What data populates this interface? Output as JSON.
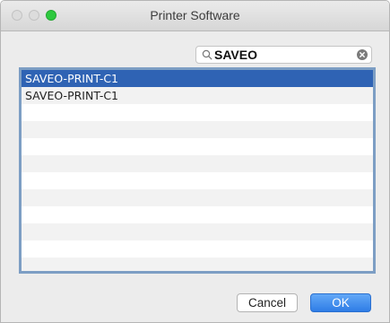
{
  "window": {
    "title": "Printer Software",
    "traffic_lights": {
      "close": "#dcdcdc",
      "minimize": "#dcdcdc",
      "zoom": "#2ec93f"
    }
  },
  "search": {
    "value": "SAVEO",
    "icon": "magnifier",
    "clear_icon": "x-circle"
  },
  "list": {
    "items": [
      {
        "label": "SAVEO-PRINT-C1",
        "selected": true
      },
      {
        "label": "SAVEO-PRINT-C1",
        "selected": false
      }
    ],
    "selection_color": "#2f63b4"
  },
  "buttons": {
    "cancel": "Cancel",
    "ok": "OK"
  }
}
